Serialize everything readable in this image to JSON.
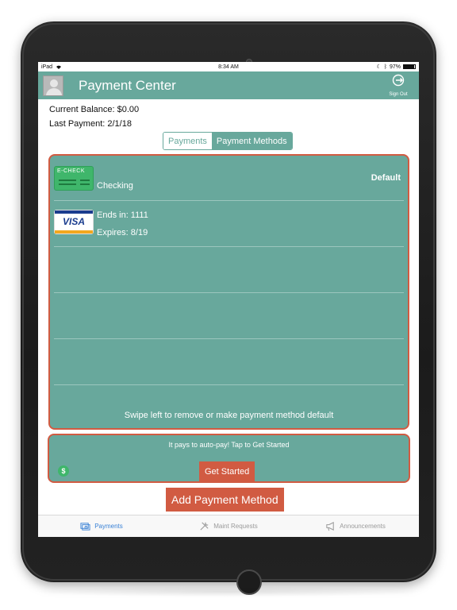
{
  "status_bar": {
    "device": "iPad",
    "time": "8:34 AM",
    "battery": "97%"
  },
  "header": {
    "title": "Payment Center",
    "sign_out_label": "Sign Out"
  },
  "account": {
    "current_balance": "Current Balance: $0.00",
    "last_payment": "Last Payment: 2/1/18"
  },
  "segment": {
    "options": [
      "Payments",
      "Payment Methods"
    ],
    "selected": "Payment Methods"
  },
  "methods": [
    {
      "card_text": "E-CHECK",
      "line1": "Checking",
      "badge": "Default"
    },
    {
      "card_text": "VISA",
      "line1": "Ends in: 1111",
      "line2": "Expires: 8/19"
    }
  ],
  "swipe_hint": "Swipe left to remove or make payment method default",
  "autopay": {
    "message": "It pays to auto-pay!  Tap to Get Started",
    "button": "Get Started",
    "icon_text": "$"
  },
  "add_button": "Add Payment Method",
  "tabbar": {
    "items": [
      "Payments",
      "Maint Requests",
      "Announcements"
    ],
    "active": "Payments"
  },
  "colors": {
    "primary": "#68a89c",
    "accent": "#d15b42",
    "tab_active": "#3a82d6"
  }
}
